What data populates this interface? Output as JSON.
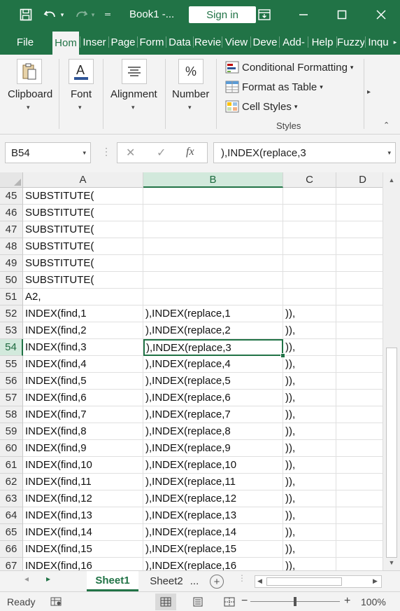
{
  "titlebar": {
    "title": "Book1  -...",
    "signin": "Sign in",
    "icons": [
      "save-icon",
      "undo-icon",
      "redo-icon",
      "quick-access-customize-icon",
      "ribbon-display-options-icon",
      "minimize-icon",
      "maximize-icon",
      "close-icon"
    ]
  },
  "menu": {
    "items": [
      "File",
      "Hom",
      "Inser",
      "Page",
      "Form",
      "Data",
      "Revie",
      "View",
      "Deve",
      "Add-",
      "Help",
      "Fuzzy",
      "Inqu"
    ],
    "active": "Hom"
  },
  "ribbon": {
    "clipboard": "Clipboard",
    "font": "Font",
    "alignment": "Alignment",
    "number": "Number",
    "number_icon": "%",
    "conditional_formatting": "Conditional Formatting",
    "format_as_table": "Format as Table",
    "cell_styles": "Cell Styles",
    "styles_caption": "Styles"
  },
  "formula_bar": {
    "name_box": "B54",
    "fx": "fx",
    "value": "),INDEX(replace,3"
  },
  "columns": [
    "A",
    "B",
    "C",
    "D"
  ],
  "selected_column": "B",
  "selected_row": "54",
  "rows": [
    {
      "n": "45",
      "a": "SUBSTITUTE(",
      "b": "",
      "c": ""
    },
    {
      "n": "46",
      "a": "SUBSTITUTE(",
      "b": "",
      "c": ""
    },
    {
      "n": "47",
      "a": "SUBSTITUTE(",
      "b": "",
      "c": ""
    },
    {
      "n": "48",
      "a": "SUBSTITUTE(",
      "b": "",
      "c": ""
    },
    {
      "n": "49",
      "a": "SUBSTITUTE(",
      "b": "",
      "c": ""
    },
    {
      "n": "50",
      "a": "SUBSTITUTE(",
      "b": "",
      "c": ""
    },
    {
      "n": "51",
      "a": "A2,",
      "b": "",
      "c": ""
    },
    {
      "n": "52",
      "a": "INDEX(find,1",
      "b": "),INDEX(replace,1",
      "c": ")),"
    },
    {
      "n": "53",
      "a": "INDEX(find,2",
      "b": "),INDEX(replace,2",
      "c": ")),"
    },
    {
      "n": "54",
      "a": "INDEX(find,3",
      "b": "),INDEX(replace,3",
      "c": ")),"
    },
    {
      "n": "55",
      "a": "INDEX(find,4",
      "b": "),INDEX(replace,4",
      "c": ")),"
    },
    {
      "n": "56",
      "a": "INDEX(find,5",
      "b": "),INDEX(replace,5",
      "c": ")),"
    },
    {
      "n": "57",
      "a": "INDEX(find,6",
      "b": "),INDEX(replace,6",
      "c": ")),"
    },
    {
      "n": "58",
      "a": "INDEX(find,7",
      "b": "),INDEX(replace,7",
      "c": ")),"
    },
    {
      "n": "59",
      "a": "INDEX(find,8",
      "b": "),INDEX(replace,8",
      "c": ")),"
    },
    {
      "n": "60",
      "a": "INDEX(find,9",
      "b": "),INDEX(replace,9",
      "c": ")),"
    },
    {
      "n": "61",
      "a": "INDEX(find,10",
      "b": "),INDEX(replace,10",
      "c": ")),"
    },
    {
      "n": "62",
      "a": "INDEX(find,11",
      "b": "),INDEX(replace,11",
      "c": ")),"
    },
    {
      "n": "63",
      "a": "INDEX(find,12",
      "b": "),INDEX(replace,12",
      "c": ")),"
    },
    {
      "n": "64",
      "a": "INDEX(find,13",
      "b": "),INDEX(replace,13",
      "c": ")),"
    },
    {
      "n": "65",
      "a": "INDEX(find,14",
      "b": "),INDEX(replace,14",
      "c": ")),"
    },
    {
      "n": "66",
      "a": "INDEX(find,15",
      "b": "),INDEX(replace,15",
      "c": ")),"
    },
    {
      "n": "67",
      "a": "INDEX(find,16",
      "b": "),INDEX(replace,16",
      "c": ")),"
    }
  ],
  "sheets": {
    "tabs": [
      "Sheet1",
      "Sheet2"
    ],
    "active": "Sheet1",
    "more": "..."
  },
  "status": {
    "ready": "Ready",
    "zoom": "100%",
    "zoom_fraction": 0.5
  },
  "colors": {
    "brand": "#217346",
    "header_selected": "#d2e9dc"
  }
}
